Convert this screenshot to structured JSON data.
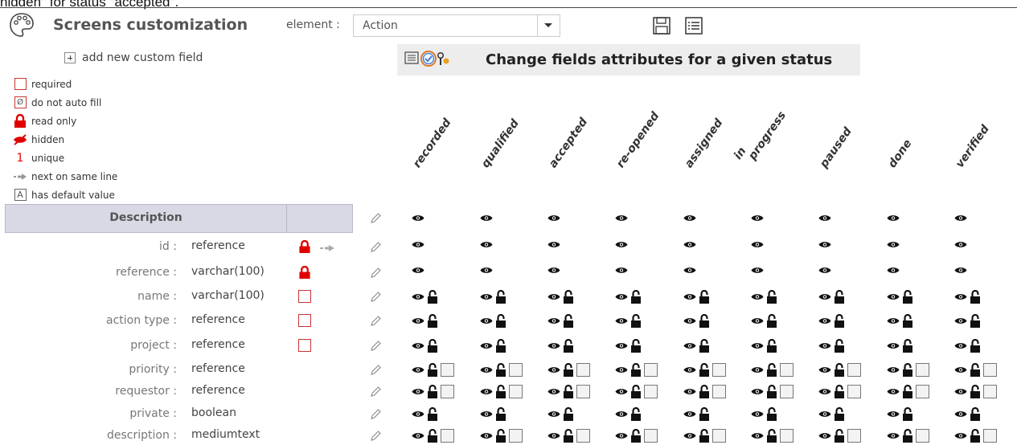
{
  "tooltip_cut": "hidden\" for status \"accepted\".",
  "header": {
    "title": "Screens customization",
    "element_label": "element :",
    "element_value": "Action",
    "icons": [
      "palette-icon",
      "save-icon",
      "list-icon"
    ]
  },
  "add_field": {
    "label": "add new custom field"
  },
  "legend": [
    {
      "icon": "required",
      "label": "required"
    },
    {
      "icon": "no-auto-fill",
      "label": "do not auto fill",
      "symbol": "Ø"
    },
    {
      "icon": "read-only-lock",
      "label": "read only"
    },
    {
      "icon": "hidden-eye",
      "label": "hidden"
    },
    {
      "icon": "unique-one",
      "label": "unique",
      "symbol": "1"
    },
    {
      "icon": "next-arrow",
      "label": "next on same line"
    },
    {
      "icon": "default-value",
      "label": "has default value",
      "symbol": "A"
    }
  ],
  "status_bar": {
    "title": "Change fields attributes for a given status"
  },
  "statuses": [
    {
      "label": "recorded"
    },
    {
      "label": "qualified"
    },
    {
      "label": "accepted"
    },
    {
      "label": "re-opened"
    },
    {
      "label": "assigned"
    },
    {
      "label": "in progress"
    },
    {
      "label": "paused"
    },
    {
      "label": "done"
    },
    {
      "label": "verified"
    }
  ],
  "table": {
    "header": "Description",
    "rows": [
      {
        "label": "id :",
        "type": "reference",
        "flag": "lock",
        "next": true,
        "cell": "eye"
      },
      {
        "label": "reference :",
        "type": "varchar(100)",
        "flag": "lock",
        "next": false,
        "cell": "eye"
      },
      {
        "label": "name :",
        "type": "varchar(100)",
        "flag": "required",
        "next": false,
        "cell": "eye-lock"
      },
      {
        "label": "action type :",
        "type": "reference",
        "flag": "required",
        "next": false,
        "cell": "eye-lock"
      },
      {
        "label": "project :",
        "type": "reference",
        "flag": "required",
        "next": false,
        "cell": "eye-lock"
      },
      {
        "label": "priority :",
        "type": "reference",
        "flag": "",
        "next": false,
        "cell": "eye-lock-box"
      },
      {
        "label": "requestor :",
        "type": "reference",
        "flag": "",
        "next": false,
        "cell": "eye-lock-box"
      },
      {
        "label": "private :",
        "type": "boolean",
        "flag": "",
        "next": false,
        "cell": "eye-lock"
      },
      {
        "label": "description :",
        "type": "mediumtext",
        "flag": "",
        "next": false,
        "cell": "eye-lock-box"
      }
    ]
  },
  "colors": {
    "accent_red": "#e00000",
    "header_bg": "#d9d9e6",
    "status_bg": "#ededed"
  }
}
